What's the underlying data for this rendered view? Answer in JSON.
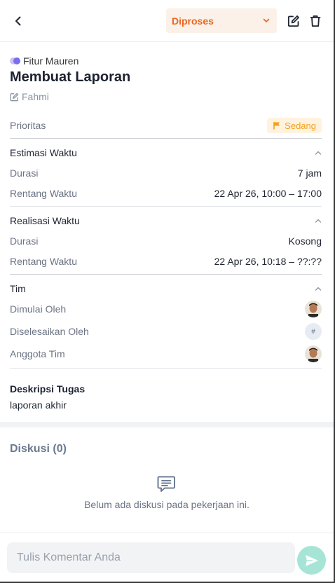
{
  "header": {
    "status_value": "Diproses",
    "status_color": "#e8661f",
    "icons": [
      "back-arrow-icon",
      "chevron-down-icon",
      "edit-icon",
      "trash-icon"
    ]
  },
  "task": {
    "feature": "Fitur Mauren",
    "title": "Membuat Laporan",
    "author": "Fahmi"
  },
  "priority": {
    "label": "Prioritas",
    "value": "Sedang",
    "color": "#f2a01c"
  },
  "estimate": {
    "title": "Estimasi Waktu",
    "duration_label": "Durasi",
    "duration_value": "7 jam",
    "range_label": "Rentang Waktu",
    "range_value": "22 Apr 26, 10:00 – 17:00"
  },
  "realization": {
    "title": "Realisasi Waktu",
    "duration_label": "Durasi",
    "duration_value": "Kosong",
    "range_label": "Rentang Waktu",
    "range_value": "22 Apr 26, 10:18 – ??:??"
  },
  "team": {
    "title": "Tim",
    "started_by_label": "Dimulai Oleh",
    "finished_by_label": "Diselesaikan Oleh",
    "finished_by_placeholder": "#",
    "members_label": "Anggota Tim"
  },
  "description": {
    "title": "Deskripsi Tugas",
    "body": "laporan akhir"
  },
  "discussion": {
    "title": "Diskusi (0)",
    "empty_text": "Belum ada diskusi pada pekerjaan ini."
  },
  "composer": {
    "placeholder": "Tulis Komentar Anda",
    "send_color": "#a6e5d6"
  }
}
